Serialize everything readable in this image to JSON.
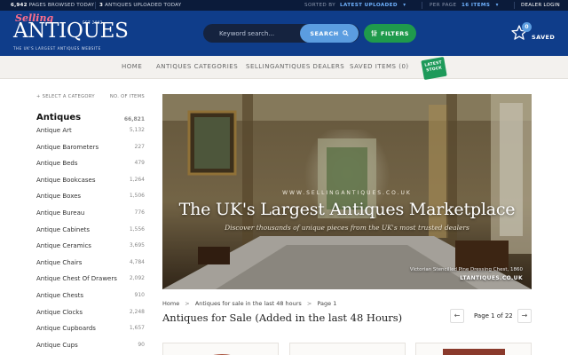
{
  "topbar": {
    "pages_browsed_count": "6,942",
    "pages_browsed_label": "PAGES BROWSED TODAY",
    "uploaded_count": "3",
    "uploaded_label": "ANTIQUES UPLOADED TODAY",
    "sorted_by_label": "SORTED BY",
    "sorted_by_value": "LATEST UPLOADED",
    "per_page_label": "PER PAGE",
    "per_page_value": "16 ITEMS",
    "dealer_login": "DEALER LOGIN"
  },
  "header": {
    "logo_script": "Selling",
    "logo_word": "ANTIQUES",
    "logo_est": "EST 2002",
    "logo_tagline": "THE UK'S LARGEST ANTIQUES WEBSITE",
    "search_placeholder": "Keyword search...",
    "search_button": "SEARCH",
    "filters_button": "FILTERS",
    "saved_count": "0",
    "saved_label": "SAVED"
  },
  "nav": {
    "items": [
      "HOME",
      "ANTIQUES CATEGORIES",
      "SELLINGANTIQUES DEALERS",
      "SAVED ITEMS (0)"
    ],
    "badge": "LATEST STOCK"
  },
  "sidebar": {
    "select_label": "+ SELECT A CATEGORY",
    "count_label": "NO. OF ITEMS",
    "top": {
      "label": "Antiques",
      "count": "66,821"
    },
    "categories": [
      {
        "label": "Antique Art",
        "count": "5,132"
      },
      {
        "label": "Antique Barometers",
        "count": "227"
      },
      {
        "label": "Antique Beds",
        "count": "479"
      },
      {
        "label": "Antique Bookcases",
        "count": "1,264"
      },
      {
        "label": "Antique Boxes",
        "count": "1,506"
      },
      {
        "label": "Antique Bureau",
        "count": "776"
      },
      {
        "label": "Antique Cabinets",
        "count": "1,556"
      },
      {
        "label": "Antique Ceramics",
        "count": "3,695"
      },
      {
        "label": "Antique Chairs",
        "count": "4,784"
      },
      {
        "label": "Antique Chest Of Drawers",
        "count": "2,092"
      },
      {
        "label": "Antique Chests",
        "count": "910"
      },
      {
        "label": "Antique Clocks",
        "count": "2,248"
      },
      {
        "label": "Antique Cupboards",
        "count": "1,657"
      },
      {
        "label": "Antique Cups",
        "count": "90"
      }
    ]
  },
  "hero": {
    "site": "WWW.SELLINGANTIQUES.CO.UK",
    "title": "The UK's Largest Antiques Marketplace",
    "subtitle": "Discover thousands of unique pieces from the UK's most trusted dealers",
    "caption": "Victorian Stencilled Pine Dressing Chest, 1860",
    "caption_source": "LTANTIQUES.CO.UK"
  },
  "breadcrumb": {
    "home": "Home",
    "section": "Antiques for sale in the last 48 hours",
    "current": "Page 1"
  },
  "listing": {
    "title": "Antiques for Sale (Added in the last 48 Hours)",
    "page_text": "Page 1 of 22",
    "prev": "←",
    "next": "→"
  }
}
